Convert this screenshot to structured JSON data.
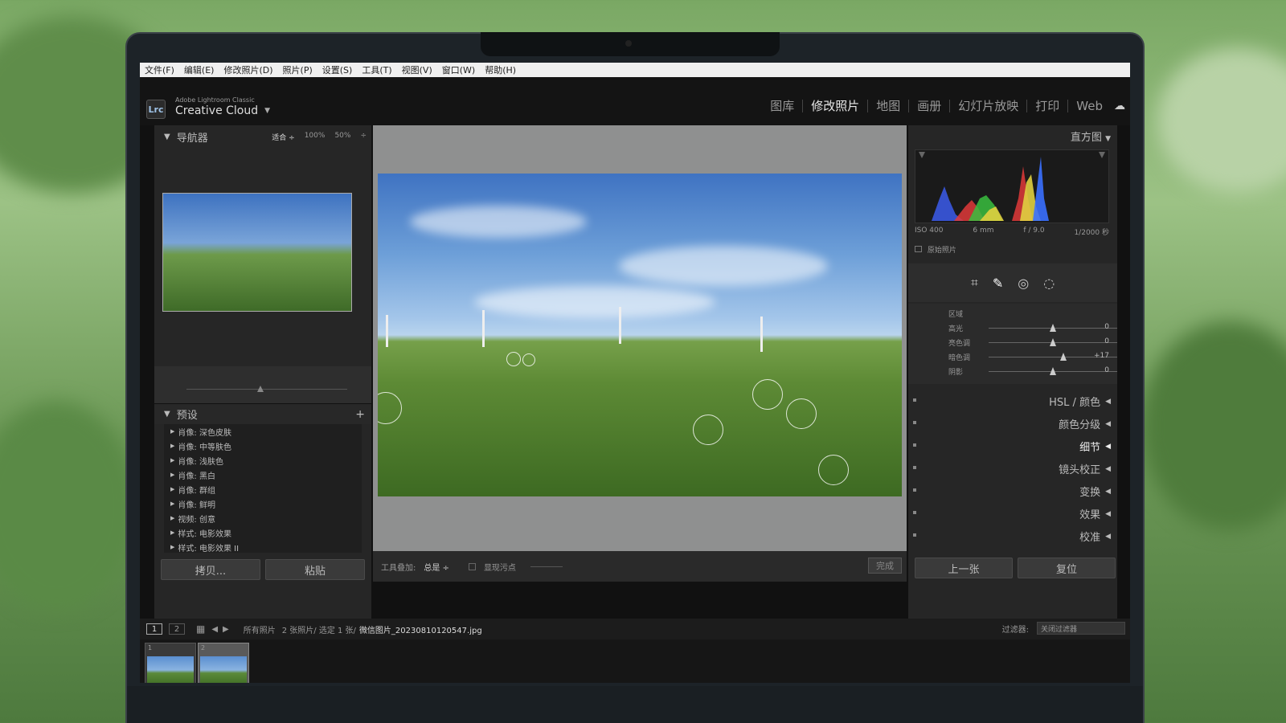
{
  "menu": [
    "文件(F)",
    "编辑(E)",
    "修改照片(D)",
    "照片(P)",
    "设置(S)",
    "工具(T)",
    "视图(V)",
    "窗口(W)",
    "帮助(H)"
  ],
  "app": {
    "logo": "Lrc",
    "name_small": "Adobe Lightroom Classic",
    "name_big": "Creative Cloud",
    "arrow": "▼"
  },
  "modules": [
    {
      "label": "图库",
      "active": false
    },
    {
      "label": "修改照片",
      "active": true
    },
    {
      "label": "地图",
      "active": false
    },
    {
      "label": "画册",
      "active": false
    },
    {
      "label": "幻灯片放映",
      "active": false
    },
    {
      "label": "打印",
      "active": false
    },
    {
      "label": "Web",
      "active": false
    }
  ],
  "navigator": {
    "title": "导航器",
    "zoom": [
      "适合 ÷",
      "100%",
      "50%",
      "÷"
    ]
  },
  "presets": {
    "title": "预设",
    "add": "+",
    "items": [
      "肖像: 深色皮肤",
      "肖像: 中等肤色",
      "肖像: 浅肤色",
      "肖像: 黑白",
      "肖像: 群组",
      "肖像: 鲜明",
      "视频: 创意",
      "样式: 电影效果",
      "样式: 电影效果 II"
    ]
  },
  "left_buttons": {
    "copy": "拷贝...",
    "paste": "粘贴"
  },
  "toolbar": {
    "overlay_label": "工具叠加:",
    "overlay_value": "总是 ÷",
    "spots_label": "显现污点",
    "done": "完成"
  },
  "histogram": {
    "title": "直方图",
    "iso": "ISO 400",
    "focal": "6 mm",
    "aperture": "f / 9.0",
    "shutter": "1/2000 秒",
    "original": "原始照片"
  },
  "region": {
    "title": "区域",
    "sliders": [
      {
        "label": "高光",
        "value": "0",
        "pos": 0.5
      },
      {
        "label": "亮色调",
        "value": "0",
        "pos": 0.5
      },
      {
        "label": "暗色调",
        "value": "+17",
        "pos": 0.58
      },
      {
        "label": "阴影",
        "value": "0",
        "pos": 0.5
      }
    ]
  },
  "right_panels": [
    "HSL / 颜色",
    "颜色分级",
    "细节",
    "镜头校正",
    "变换",
    "效果",
    "校准"
  ],
  "right_buttons": {
    "prev": "上一张",
    "reset": "复位"
  },
  "filmbar": {
    "page1": "1",
    "page2": "2",
    "source": "所有照片",
    "info": "2 张照片/ 选定 1 张/",
    "filename": "微信图片_20230810120547.jpg",
    "filter_label": "过滤器:",
    "filter_value": "关闭过滤器"
  },
  "film": [
    {
      "num": "1"
    },
    {
      "num": "2"
    }
  ],
  "colors": {
    "accent": "#2d6fb8",
    "panel": "#262626",
    "menubar": "#f0f0f0"
  }
}
